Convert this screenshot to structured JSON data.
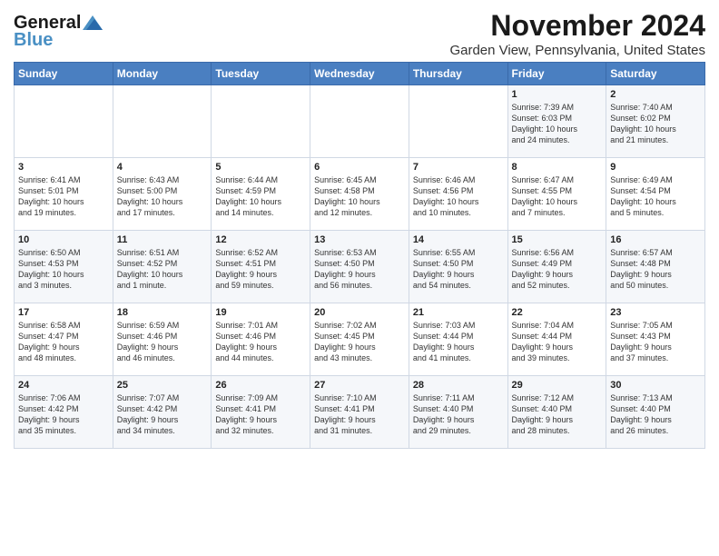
{
  "header": {
    "logo_line1": "General",
    "logo_line2": "Blue",
    "month_title": "November 2024",
    "subtitle": "Garden View, Pennsylvania, United States"
  },
  "weekdays": [
    "Sunday",
    "Monday",
    "Tuesday",
    "Wednesday",
    "Thursday",
    "Friday",
    "Saturday"
  ],
  "weeks": [
    [
      {
        "day": "",
        "info": ""
      },
      {
        "day": "",
        "info": ""
      },
      {
        "day": "",
        "info": ""
      },
      {
        "day": "",
        "info": ""
      },
      {
        "day": "",
        "info": ""
      },
      {
        "day": "1",
        "info": "Sunrise: 7:39 AM\nSunset: 6:03 PM\nDaylight: 10 hours\nand 24 minutes."
      },
      {
        "day": "2",
        "info": "Sunrise: 7:40 AM\nSunset: 6:02 PM\nDaylight: 10 hours\nand 21 minutes."
      }
    ],
    [
      {
        "day": "3",
        "info": "Sunrise: 6:41 AM\nSunset: 5:01 PM\nDaylight: 10 hours\nand 19 minutes."
      },
      {
        "day": "4",
        "info": "Sunrise: 6:43 AM\nSunset: 5:00 PM\nDaylight: 10 hours\nand 17 minutes."
      },
      {
        "day": "5",
        "info": "Sunrise: 6:44 AM\nSunset: 4:59 PM\nDaylight: 10 hours\nand 14 minutes."
      },
      {
        "day": "6",
        "info": "Sunrise: 6:45 AM\nSunset: 4:58 PM\nDaylight: 10 hours\nand 12 minutes."
      },
      {
        "day": "7",
        "info": "Sunrise: 6:46 AM\nSunset: 4:56 PM\nDaylight: 10 hours\nand 10 minutes."
      },
      {
        "day": "8",
        "info": "Sunrise: 6:47 AM\nSunset: 4:55 PM\nDaylight: 10 hours\nand 7 minutes."
      },
      {
        "day": "9",
        "info": "Sunrise: 6:49 AM\nSunset: 4:54 PM\nDaylight: 10 hours\nand 5 minutes."
      }
    ],
    [
      {
        "day": "10",
        "info": "Sunrise: 6:50 AM\nSunset: 4:53 PM\nDaylight: 10 hours\nand 3 minutes."
      },
      {
        "day": "11",
        "info": "Sunrise: 6:51 AM\nSunset: 4:52 PM\nDaylight: 10 hours\nand 1 minute."
      },
      {
        "day": "12",
        "info": "Sunrise: 6:52 AM\nSunset: 4:51 PM\nDaylight: 9 hours\nand 59 minutes."
      },
      {
        "day": "13",
        "info": "Sunrise: 6:53 AM\nSunset: 4:50 PM\nDaylight: 9 hours\nand 56 minutes."
      },
      {
        "day": "14",
        "info": "Sunrise: 6:55 AM\nSunset: 4:50 PM\nDaylight: 9 hours\nand 54 minutes."
      },
      {
        "day": "15",
        "info": "Sunrise: 6:56 AM\nSunset: 4:49 PM\nDaylight: 9 hours\nand 52 minutes."
      },
      {
        "day": "16",
        "info": "Sunrise: 6:57 AM\nSunset: 4:48 PM\nDaylight: 9 hours\nand 50 minutes."
      }
    ],
    [
      {
        "day": "17",
        "info": "Sunrise: 6:58 AM\nSunset: 4:47 PM\nDaylight: 9 hours\nand 48 minutes."
      },
      {
        "day": "18",
        "info": "Sunrise: 6:59 AM\nSunset: 4:46 PM\nDaylight: 9 hours\nand 46 minutes."
      },
      {
        "day": "19",
        "info": "Sunrise: 7:01 AM\nSunset: 4:46 PM\nDaylight: 9 hours\nand 44 minutes."
      },
      {
        "day": "20",
        "info": "Sunrise: 7:02 AM\nSunset: 4:45 PM\nDaylight: 9 hours\nand 43 minutes."
      },
      {
        "day": "21",
        "info": "Sunrise: 7:03 AM\nSunset: 4:44 PM\nDaylight: 9 hours\nand 41 minutes."
      },
      {
        "day": "22",
        "info": "Sunrise: 7:04 AM\nSunset: 4:44 PM\nDaylight: 9 hours\nand 39 minutes."
      },
      {
        "day": "23",
        "info": "Sunrise: 7:05 AM\nSunset: 4:43 PM\nDaylight: 9 hours\nand 37 minutes."
      }
    ],
    [
      {
        "day": "24",
        "info": "Sunrise: 7:06 AM\nSunset: 4:42 PM\nDaylight: 9 hours\nand 35 minutes."
      },
      {
        "day": "25",
        "info": "Sunrise: 7:07 AM\nSunset: 4:42 PM\nDaylight: 9 hours\nand 34 minutes."
      },
      {
        "day": "26",
        "info": "Sunrise: 7:09 AM\nSunset: 4:41 PM\nDaylight: 9 hours\nand 32 minutes."
      },
      {
        "day": "27",
        "info": "Sunrise: 7:10 AM\nSunset: 4:41 PM\nDaylight: 9 hours\nand 31 minutes."
      },
      {
        "day": "28",
        "info": "Sunrise: 7:11 AM\nSunset: 4:40 PM\nDaylight: 9 hours\nand 29 minutes."
      },
      {
        "day": "29",
        "info": "Sunrise: 7:12 AM\nSunset: 4:40 PM\nDaylight: 9 hours\nand 28 minutes."
      },
      {
        "day": "30",
        "info": "Sunrise: 7:13 AM\nSunset: 4:40 PM\nDaylight: 9 hours\nand 26 minutes."
      }
    ]
  ]
}
